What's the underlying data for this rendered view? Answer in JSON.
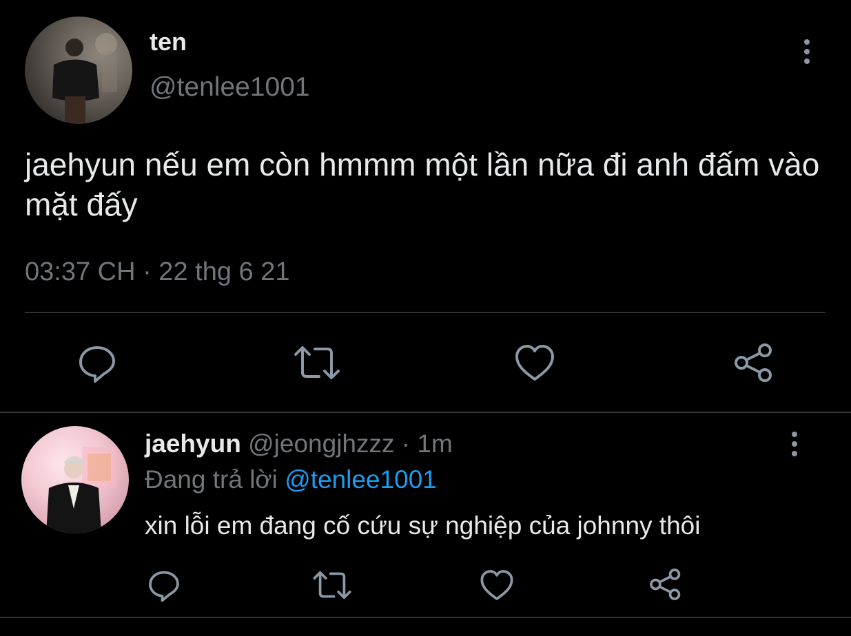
{
  "main_tweet": {
    "author_name": "ten",
    "author_handle": "@tenlee1001",
    "text": "jaehyun nếu em còn hmmm một lần nữa đi anh đấm vào mặt đấy",
    "timestamp": "03:37 CH · 22 thg 6 21",
    "actions": [
      "reply-icon",
      "retweet-icon",
      "like-icon",
      "share-icon"
    ]
  },
  "reply_tweet": {
    "author_name": "jaehyun",
    "author_handle": "@jeongjhzzz",
    "separator": " · ",
    "time_ago": "1m",
    "replying_prefix": "Đang trả lời ",
    "replying_to": "@tenlee1001",
    "text": "xin lỗi em đang cố cứu sự nghiệp của johnny thôi",
    "actions": [
      "reply-icon",
      "retweet-icon",
      "like-icon",
      "share-icon"
    ]
  },
  "colors": {
    "background": "#000000",
    "text_primary": "#e7e9ea",
    "text_secondary": "#71767b",
    "accent": "#1d9bf0",
    "icon": "#8b98a5",
    "divider": "#2f3336"
  }
}
